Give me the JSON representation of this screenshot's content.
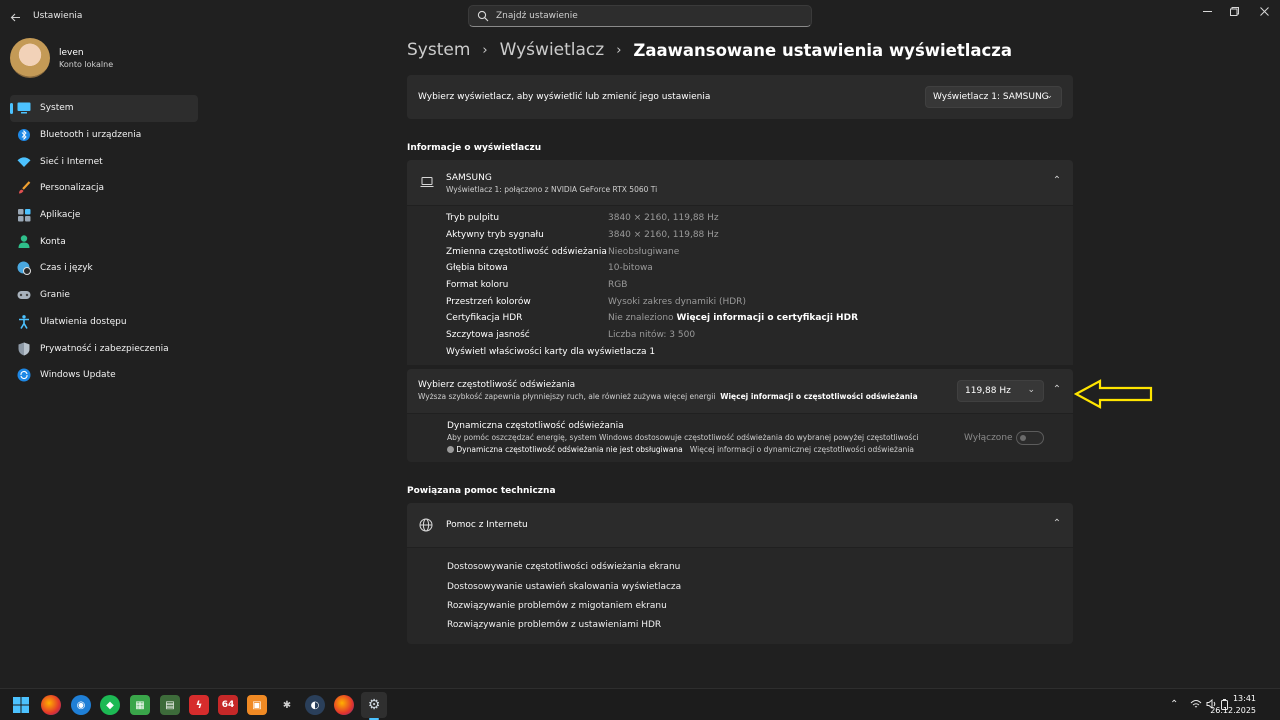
{
  "app": {
    "title": "Ustawienia"
  },
  "search": {
    "placeholder": "Znajdź ustawienie"
  },
  "profile": {
    "name": "leven",
    "account_type": "Konto lokalne"
  },
  "sidebar": {
    "items": [
      {
        "label": "System",
        "icon": "monitor-icon",
        "active": true
      },
      {
        "label": "Bluetooth i urządzenia",
        "icon": "bluetooth-icon"
      },
      {
        "label": "Sieć i Internet",
        "icon": "wifi-icon"
      },
      {
        "label": "Personalizacja",
        "icon": "brush-icon"
      },
      {
        "label": "Aplikacje",
        "icon": "apps-icon"
      },
      {
        "label": "Konta",
        "icon": "person-icon"
      },
      {
        "label": "Czas i język",
        "icon": "globe-clock-icon"
      },
      {
        "label": "Granie",
        "icon": "gamepad-icon"
      },
      {
        "label": "Ułatwienia dostępu",
        "icon": "accessibility-icon"
      },
      {
        "label": "Prywatność i zabezpieczenia",
        "icon": "shield-icon"
      },
      {
        "label": "Windows Update",
        "icon": "update-icon"
      }
    ]
  },
  "breadcrumb": {
    "level1": "System",
    "level2": "Wyświetlacz",
    "current": "Zaawansowane ustawienia wyświetlacza",
    "separator": "›"
  },
  "display_select": {
    "label": "Wybierz wyświetlacz, aby wyświetlić lub zmienić jego ustawienia",
    "value": "Wyświetlacz 1: SAMSUNG"
  },
  "display_info": {
    "section_title": "Informacje o wyświetlaczu",
    "name": "SAMSUNG",
    "connection": "Wyświetlacz 1: połączono z NVIDIA GeForce RTX 5060 Ti",
    "rows": [
      {
        "key": "Tryb pulpitu",
        "value": "3840 × 2160, 119,88 Hz"
      },
      {
        "key": "Aktywny tryb sygnału",
        "value": "3840 × 2160, 119,88 Hz"
      },
      {
        "key": "Zmienna częstotliwość odświeżania",
        "value": "Nieobsługiwane"
      },
      {
        "key": "Głębia bitowa",
        "value": "10-bitowa"
      },
      {
        "key": "Format koloru",
        "value": "RGB"
      },
      {
        "key": "Przestrzeń kolorów",
        "value": "Wysoki zakres dynamiki (HDR)"
      },
      {
        "key": "Certyfikacja HDR",
        "value": "Nie znaleziono",
        "link": "Więcej informacji o certyfikacji HDR"
      },
      {
        "key": "Szczytowa jasność",
        "value": "Liczba nitów: 3 500"
      }
    ],
    "adapter_link": "Wyświetl właściwości karty dla wyświetlacza 1"
  },
  "refresh": {
    "title": "Wybierz częstotliwość odświeżania",
    "desc": "Wyższa szybkość zapewnia płynniejszy ruch, ale również zużywa więcej energii",
    "link": "Więcej informacji o częstotliwości odświeżania",
    "value": "119,88 Hz"
  },
  "dynamic_refresh": {
    "title": "Dynamiczna częstotliwość odświeżania",
    "desc": "Aby pomóc oszczędzać energię, system Windows dostosowuje częstotliwość odświeżania do wybranej powyżej częstotliwości",
    "warning": "Dynamiczna częstotliwość odświeżania nie jest obsługiwana",
    "link": "Więcej informacji o dynamicznej częstotliwości odświeżania",
    "toggle_label": "Wyłączone",
    "toggle_on": false
  },
  "related_help": {
    "section_title": "Powiązana pomoc techniczna",
    "card_title": "Pomoc z Internetu",
    "links": [
      "Dostosowywanie częstotliwości odświeżania ekranu",
      "Dostosowywanie ustawień skalowania wyświetlacza",
      "Rozwiązywanie problemów z migotaniem ekranu",
      "Rozwiązywanie problemów z ustawieniami HDR"
    ]
  },
  "taskbar": {
    "badge_64": "64",
    "time": "13:41",
    "date": "26.12.2025"
  },
  "colors": {
    "accent": "#4cc2ff",
    "annotation": "#ffe500",
    "background": "#202020",
    "card": "#2b2b2b"
  }
}
